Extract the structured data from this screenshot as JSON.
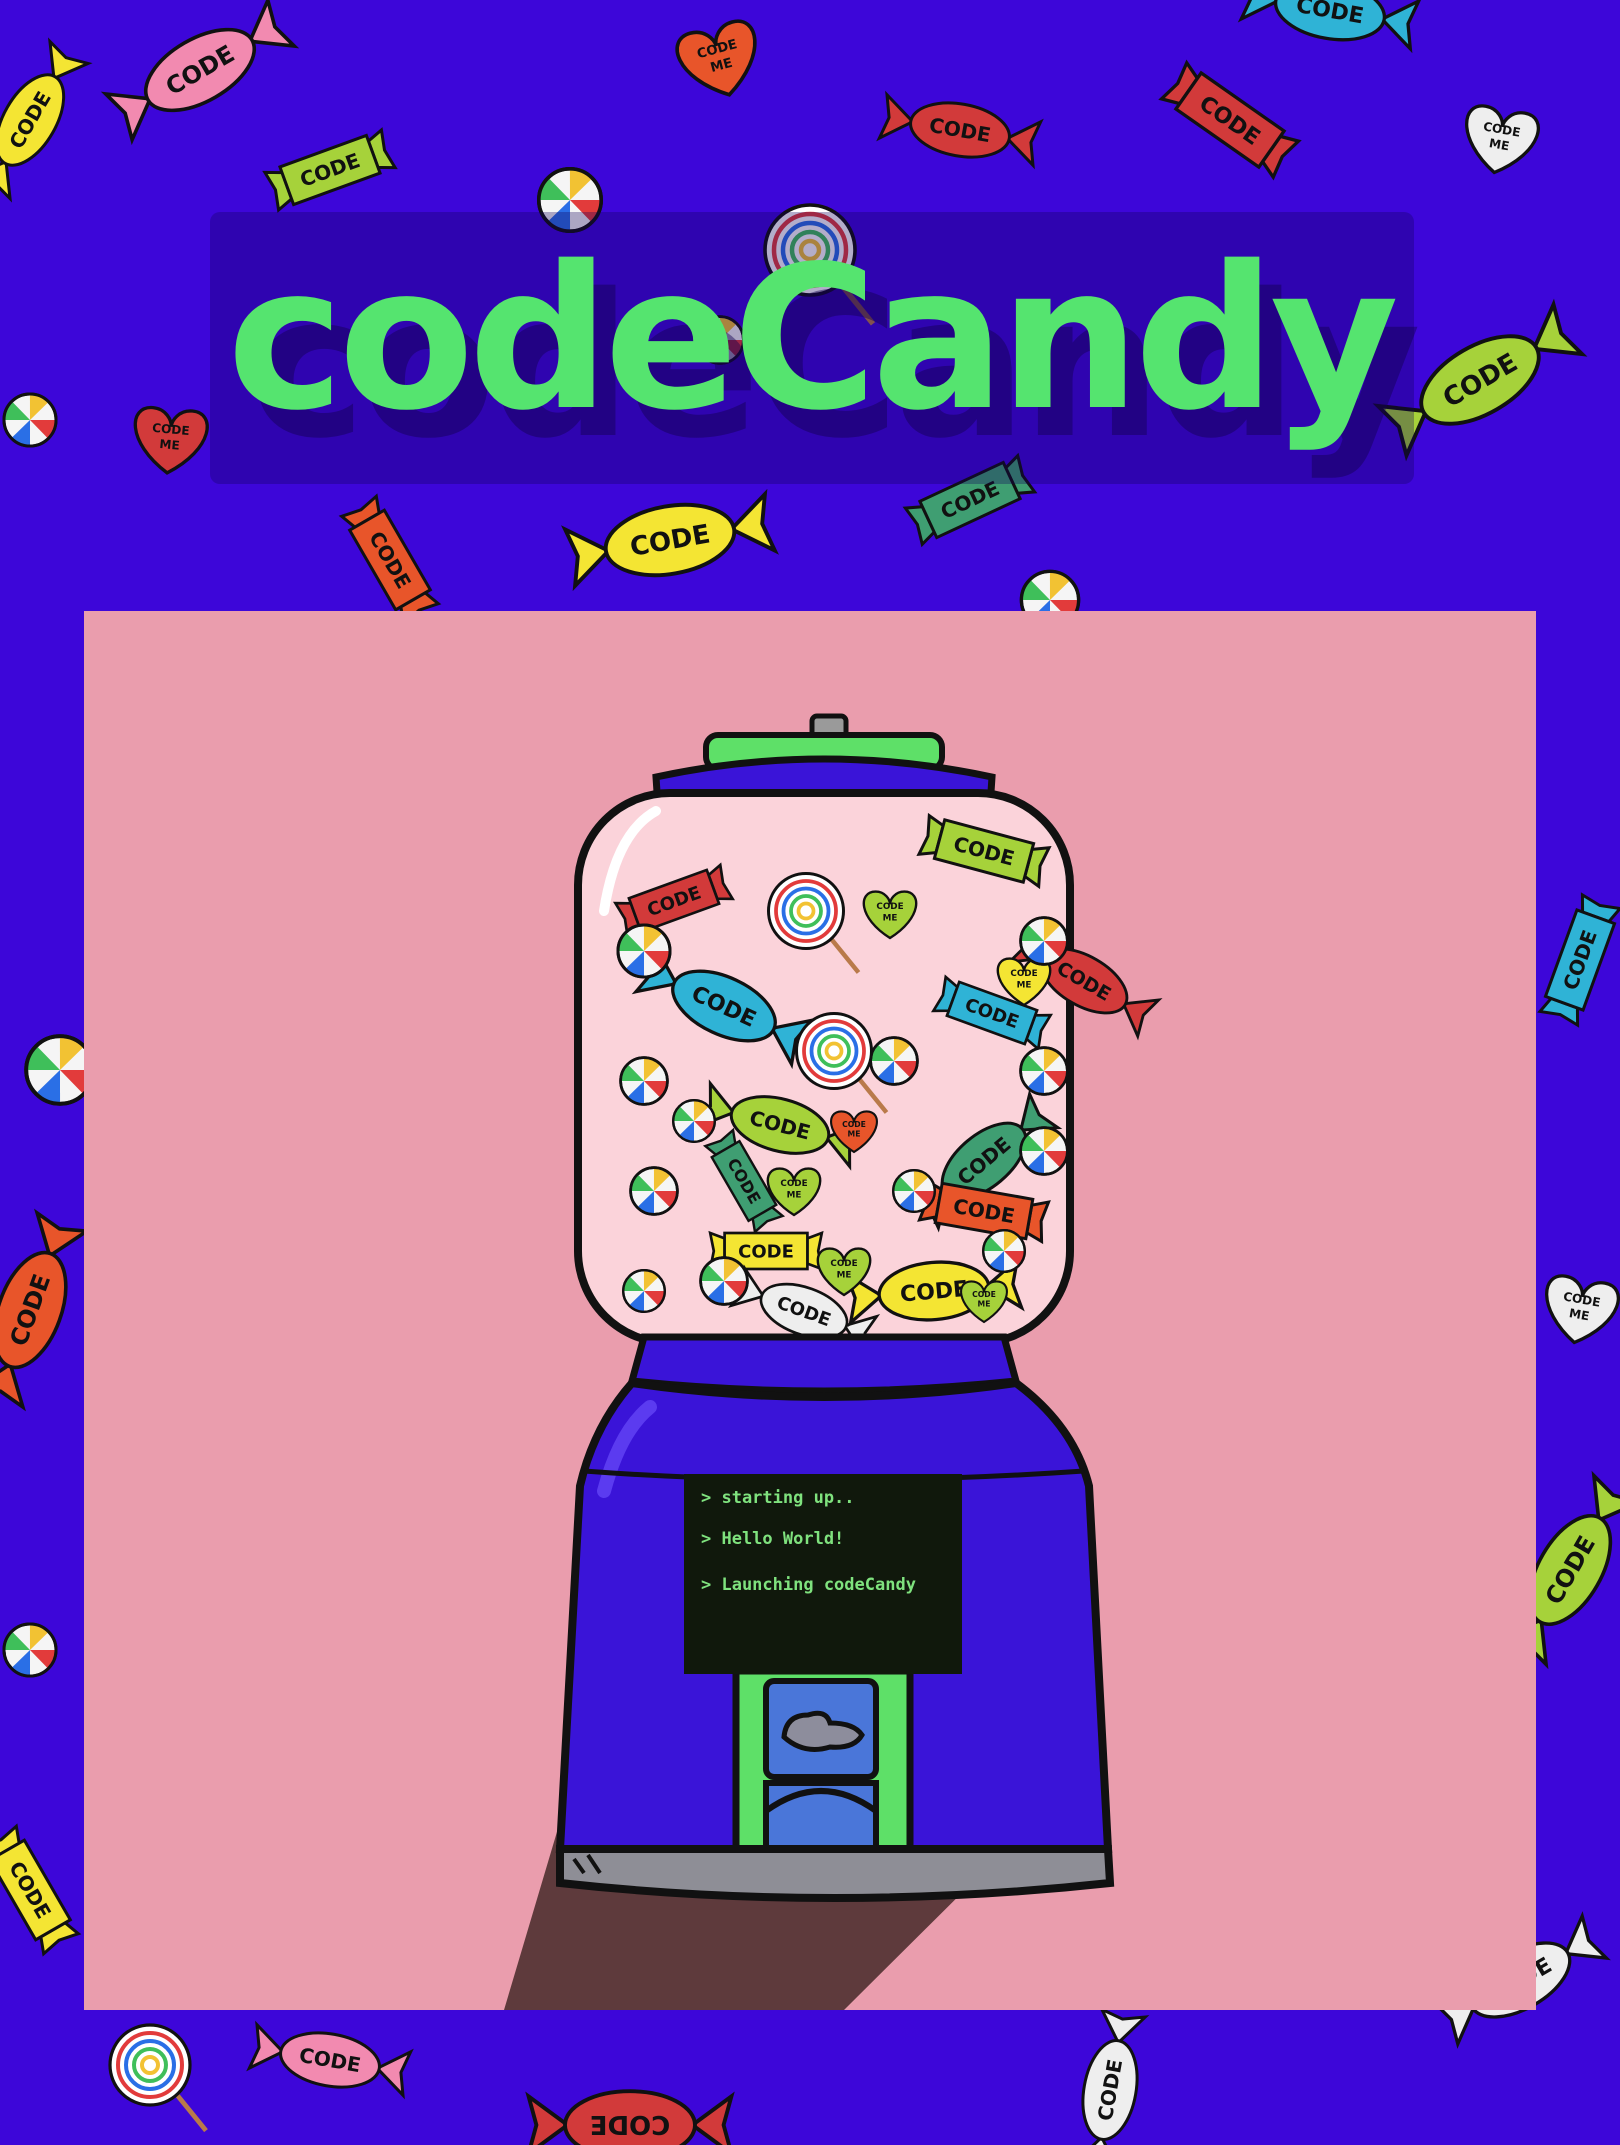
{
  "title": "codeCandy",
  "screen": {
    "lines": [
      "> starting up..",
      "> Hello World!",
      "> Launching codeCandy"
    ]
  },
  "candy_labels": {
    "wrapper": "CODE",
    "heart_line1": "CODE",
    "heart_line2": "ME"
  },
  "colors": {
    "background": "#3d06d9",
    "title": "#55e46f",
    "panel": "#ea9dad",
    "machine_body": "#3a14d8",
    "machine_accent": "#5ee068",
    "jar": "#fbd3da",
    "screen": "#10180c",
    "screen_text": "#7fe27e"
  }
}
